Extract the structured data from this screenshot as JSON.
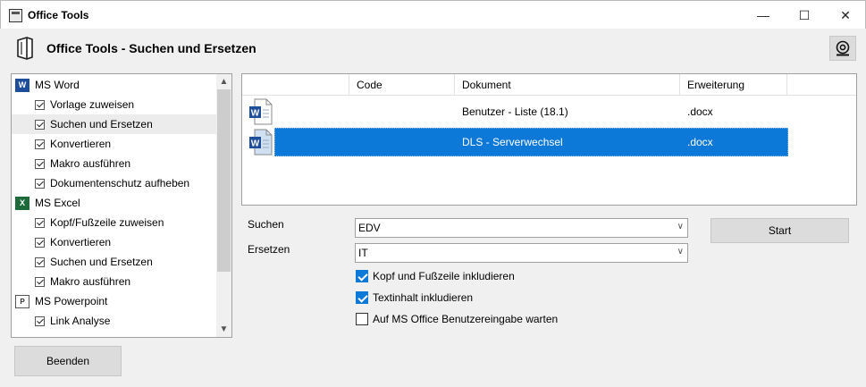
{
  "window": {
    "title": "Office Tools",
    "minimize_glyph": "—",
    "maximize_glyph": "☐",
    "close_glyph": "✕"
  },
  "header": {
    "title": "Office Tools - Suchen und Ersetzen",
    "help_icon": "lifebuoy-icon"
  },
  "tree": {
    "groups": [
      {
        "label": "MS Word",
        "icon": "word-icon",
        "items": [
          {
            "label": "Vorlage zuweisen"
          },
          {
            "label": "Suchen und Ersetzen",
            "highlighted": true
          },
          {
            "label": "Konvertieren"
          },
          {
            "label": "Makro ausführen"
          },
          {
            "label": "Dokumentenschutz aufheben"
          }
        ]
      },
      {
        "label": "MS Excel",
        "icon": "excel-icon",
        "items": [
          {
            "label": "Kopf/Fußzeile zuweisen"
          },
          {
            "label": "Konvertieren"
          },
          {
            "label": "Suchen und Ersetzen"
          },
          {
            "label": "Makro ausführen"
          }
        ]
      },
      {
        "label": "MS Powerpoint",
        "icon": "powerpoint-icon",
        "items": [
          {
            "label": "Link Analyse"
          }
        ]
      }
    ]
  },
  "quit_label": "Beenden",
  "grid": {
    "columns": [
      "Code",
      "Dokument",
      "Erweiterung"
    ],
    "rows": [
      {
        "code": "",
        "document": "Benutzer - Liste (18.1)",
        "extension": ".docx",
        "selected": false
      },
      {
        "code": "",
        "document": "DLS - Serverwechsel",
        "extension": ".docx",
        "selected": true
      }
    ]
  },
  "form": {
    "search_label": "Suchen",
    "search_value": "EDV",
    "replace_label": "Ersetzen",
    "replace_value": "IT",
    "start_label": "Start",
    "options": [
      {
        "label": "Kopf und Fußzeile inkludieren",
        "checked": true
      },
      {
        "label": "Textinhalt inkludieren",
        "checked": true
      },
      {
        "label": "Auf MS Office Benutzereingabe warten",
        "checked": false
      }
    ]
  },
  "colors": {
    "selection": "#0c78d8",
    "word_brand": "#1e4e9a",
    "excel_brand": "#1d6b3a"
  }
}
